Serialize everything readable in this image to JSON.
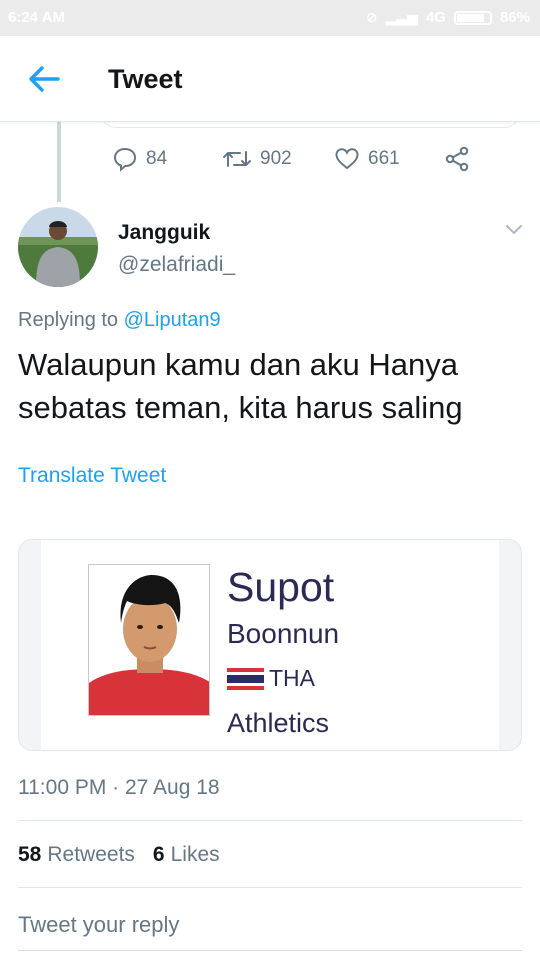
{
  "status_bar": {
    "time": "6:24 AM",
    "network": "4G",
    "battery": "86%",
    "battery_level": 0.86
  },
  "header": {
    "title": "Tweet",
    "back_icon": "arrow-left-icon"
  },
  "previous_tweet": {
    "replies": "84",
    "retweets": "902",
    "likes": "661"
  },
  "tweet": {
    "display_name": "Jangguik",
    "handle": "@zelafriadi_",
    "replying_prefix": "Replying to",
    "replying_to": "@Liputan9",
    "text": "Walaupun kamu dan aku Hanya sebatas teman, kita harus saling",
    "translate": "Translate Tweet",
    "timestamp": "11:00 PM · 27 Aug 18",
    "retweet_count": "58",
    "retweet_label": "Retweets",
    "like_count": "6",
    "like_label": "Likes"
  },
  "media_card": {
    "first_name": "Supot",
    "last_name": "Boonnun",
    "country": "THA",
    "sport": "Athletics"
  },
  "reply_box": {
    "placeholder": "Tweet your reply"
  },
  "colors": {
    "accent": "#1da1f2",
    "secondary_text": "#657786",
    "card_text": "#2b2a55"
  }
}
